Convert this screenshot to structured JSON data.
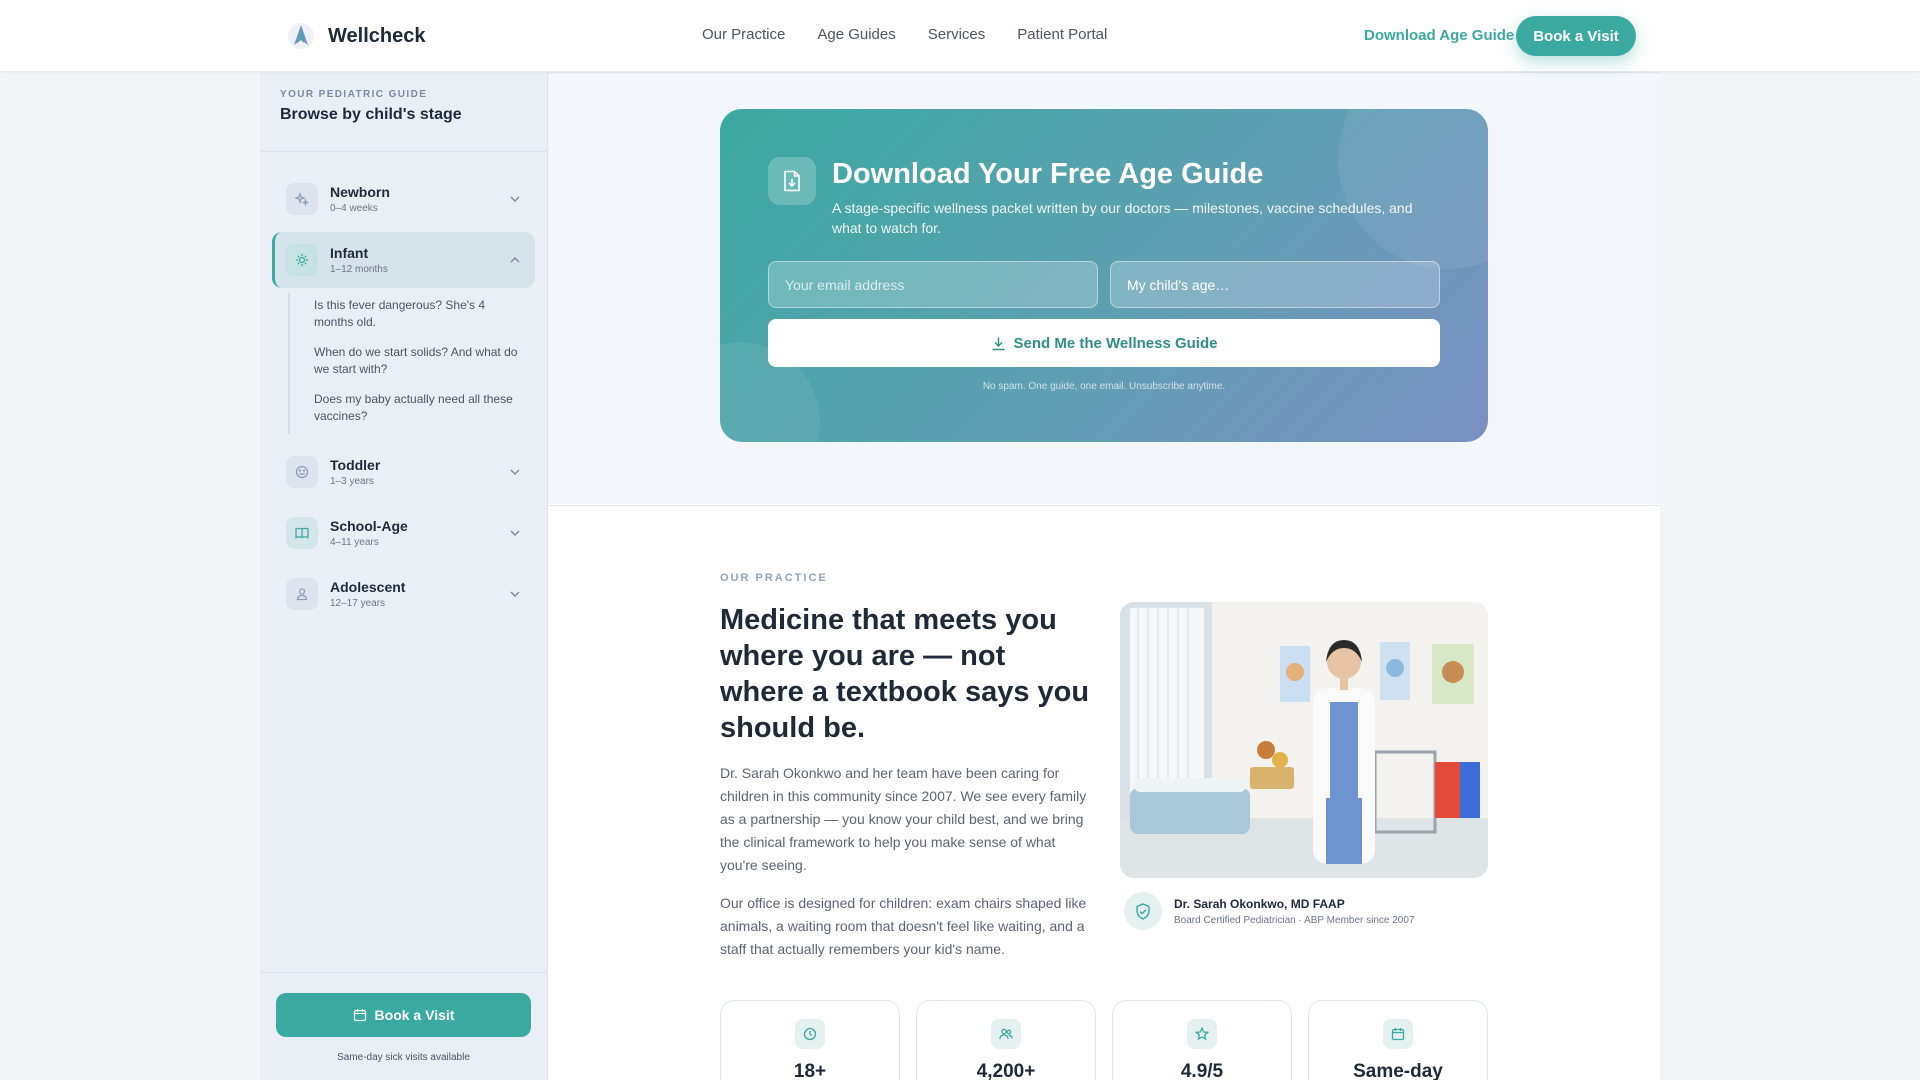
{
  "header": {
    "brand": "Wellcheck",
    "nav": [
      "Our Practice",
      "Age Guides",
      "Services",
      "Patient Portal"
    ],
    "download_link": "Download Age Guide",
    "book_button": "Book a Visit"
  },
  "sidebar": {
    "eyebrow": "YOUR PEDIATRIC GUIDE",
    "title": "Browse by child's stage",
    "stages": [
      {
        "name": "Newborn",
        "range": "0–4 weeks",
        "icon": "sparkle-icon"
      },
      {
        "name": "Infant",
        "range": "1–12 months",
        "icon": "sun-icon",
        "expanded": true
      },
      {
        "name": "Toddler",
        "range": "1–3 years",
        "icon": "smile-icon"
      },
      {
        "name": "School-Age",
        "range": "4–11 years",
        "icon": "book-icon"
      },
      {
        "name": "Adolescent",
        "range": "12–17 years",
        "icon": "user-icon"
      }
    ],
    "infant_questions": [
      "Is this fever dangerous? She's 4 months old.",
      "When do we start solids? And what do we start with?",
      "Does my baby actually need all these vaccines?"
    ],
    "book_button": "Book a Visit",
    "note": "Same-day sick visits available"
  },
  "download": {
    "title": "Download Your Free Age Guide",
    "subtitle": "A stage-specific wellness packet written by our doctors — milestones, vaccine schedules, and what to watch for.",
    "email_placeholder": "Your email address",
    "age_select": "My child's age…",
    "send_button": "Send Me the Wellness Guide",
    "note": "No spam. One guide, one email. Unsubscribe anytime."
  },
  "practice": {
    "eyebrow": "OUR PRACTICE",
    "title": "Medicine that meets you where you are — not where a textbook says you should be.",
    "p1": "Dr. Sarah Okonkwo and her team have been caring for children in this community since 2007. We see every family as a partnership — you know your child best, and we bring the clinical framework to help you make sense of what you're seeing.",
    "p2": "Our office is designed for children: exam chairs shaped like animals, a waiting room that doesn't feel like waiting, and a staff that actually remembers your kid's name.",
    "doctor_name": "Dr. Sarah Okonkwo, MD FAAP",
    "doctor_creds": "Board Certified Pediatrician · ABP Member since 2007",
    "stats": [
      {
        "value": "18+",
        "icon": "clock-icon"
      },
      {
        "value": "4,200+",
        "icon": "users-icon"
      },
      {
        "value": "4.9/5",
        "icon": "star-icon"
      },
      {
        "value": "Same-day",
        "icon": "calendar-icon"
      }
    ]
  },
  "colors": {
    "accent": "#3aa99f",
    "gradient_end": "#7b8fc4",
    "sidebar_bg": "#eaeff6"
  }
}
